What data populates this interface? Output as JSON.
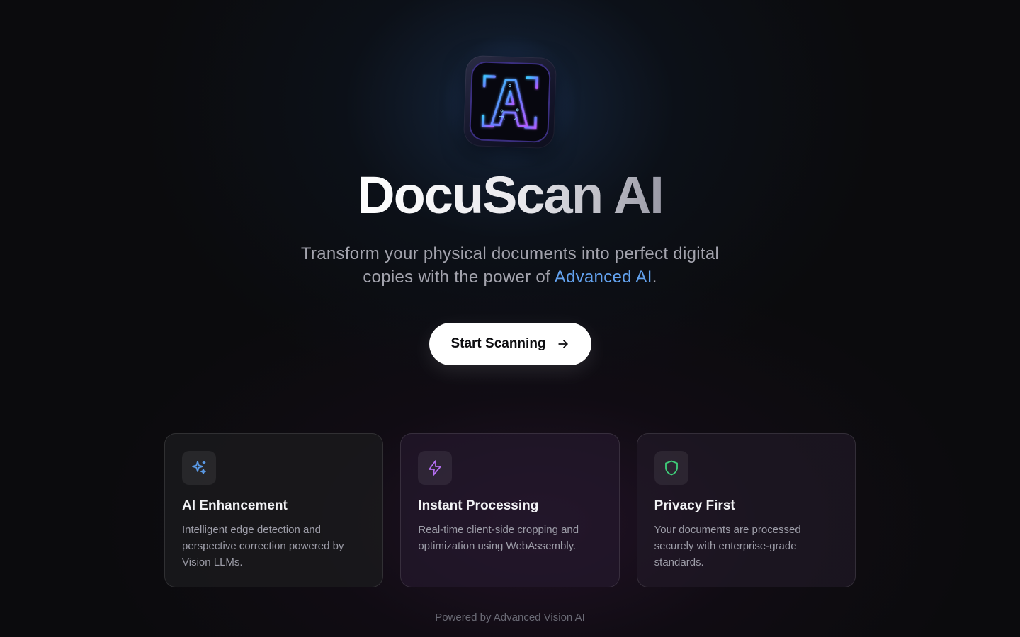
{
  "app": {
    "title": "DocuScan AI",
    "logo_icon": "scan-letter-a-icon"
  },
  "hero": {
    "subtitle_line1": "Transform your physical documents into perfect digital",
    "subtitle_line2_prefix": "copies with the power of ",
    "subtitle_accent": "Advanced AI",
    "subtitle_suffix": ".",
    "cta_label": "Start Scanning",
    "cta_icon": "arrow-right-icon"
  },
  "features": [
    {
      "icon": "sparkles-icon",
      "icon_color": "#5b9be8",
      "title": "AI Enhancement",
      "description": "Intelligent edge detection and perspective correction powered by Vision LLMs."
    },
    {
      "icon": "lightning-icon",
      "icon_color": "#b36ef0",
      "title": "Instant Processing",
      "description": "Real-time client-side cropping and optimization using WebAssembly."
    },
    {
      "icon": "shield-icon",
      "icon_color": "#3fcf7a",
      "title": "Privacy First",
      "description": "Your documents are processed securely with enterprise-grade standards."
    }
  ],
  "footer": {
    "text": "Powered by Advanced Vision AI"
  },
  "colors": {
    "accent": "#63a2ef",
    "background": "#0b0b0d",
    "cta_background": "#ffffff"
  }
}
